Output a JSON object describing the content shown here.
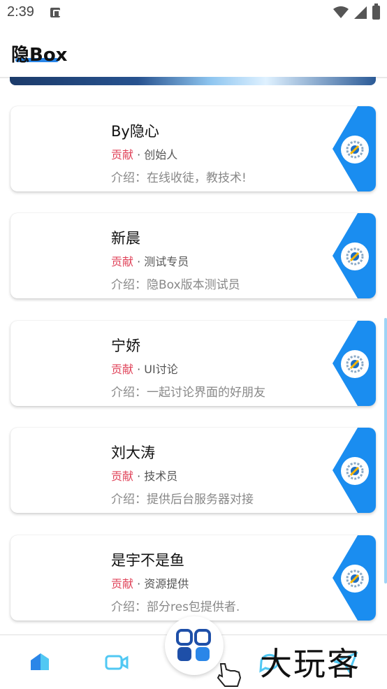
{
  "status_bar": {
    "time": "2:39"
  },
  "app_bar": {
    "title": "隐Box"
  },
  "colors": {
    "accent": "#2a86e8",
    "badge_blue": "#1a8df0",
    "role_red": "#e0455b"
  },
  "members": [
    {
      "name": "By隐心",
      "role_tag": "贡献",
      "role": " · 创始人",
      "intro": "介绍：在线收徒，教技术!"
    },
    {
      "name": "新晨",
      "role_tag": "贡献",
      "role": " · 测试专员",
      "intro": "介绍：隐Box版本测试员"
    },
    {
      "name": "宁娇",
      "role_tag": "贡献",
      "role": " · UI讨论",
      "intro": "介绍：一起讨论界面的好朋友"
    },
    {
      "name": "刘大涛",
      "role_tag": "贡献",
      "role": " · 技术员",
      "intro": "介绍：提供后台服务器对接"
    },
    {
      "name": "是宇不是鱼",
      "role_tag": "贡献",
      "role": " · 资源提供",
      "intro": "介绍：部分res包提供者."
    }
  ],
  "bottom_nav": {
    "items": [
      "home-icon",
      "video-icon",
      "apps-icon",
      "chat-icon",
      "send-icon"
    ]
  },
  "watermark": {
    "text": "大玩客"
  }
}
